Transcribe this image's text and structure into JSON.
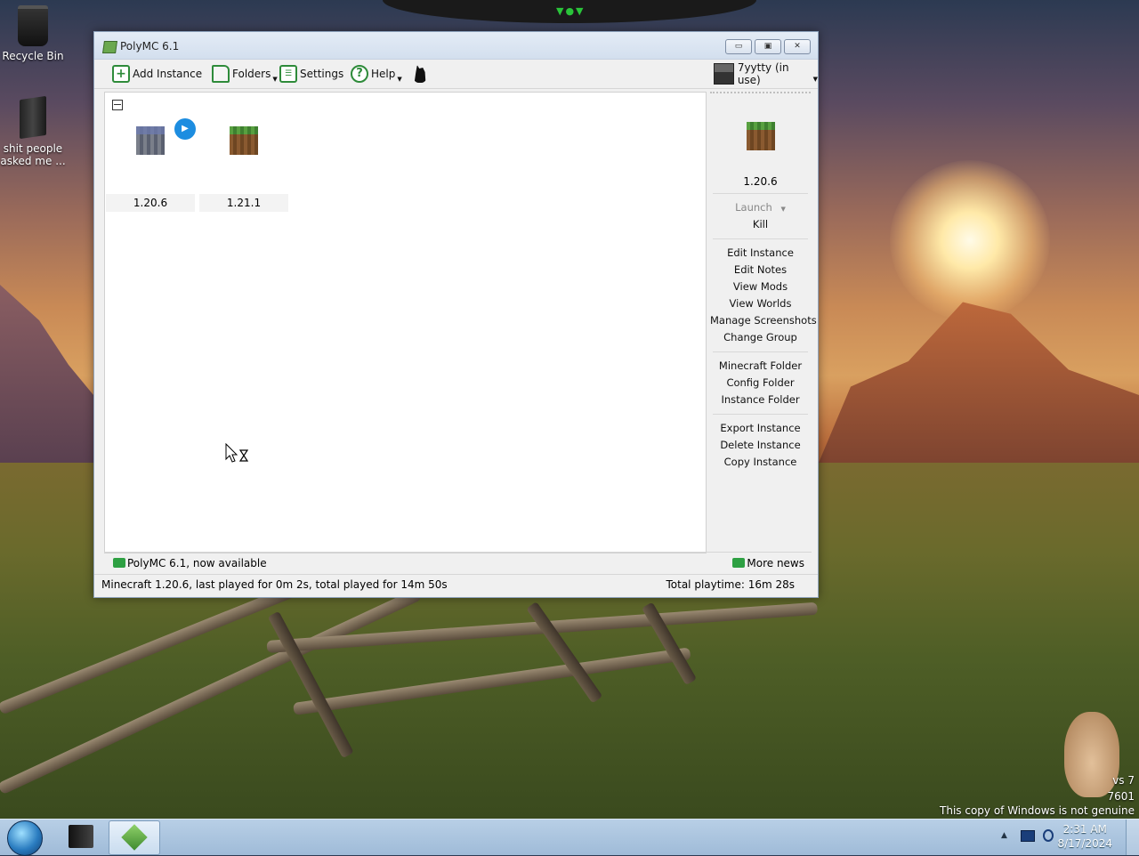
{
  "desktop": {
    "icons": [
      {
        "label": "Recycle Bin"
      },
      {
        "label_line1": "shit people",
        "label_line2": "asked me ..."
      }
    ],
    "watermark": {
      "line1": "vs 7",
      "line2": "7601",
      "line3": "This copy of Windows is not genuine"
    }
  },
  "window": {
    "title": "PolyMC 6.1",
    "controls": {
      "minimize": "▭",
      "maximize": "▣",
      "close": "✕"
    }
  },
  "toolbar": {
    "add_instance": "Add Instance",
    "folders": "Folders",
    "settings": "Settings",
    "help": "Help",
    "account": "7yytty (in use)"
  },
  "instances": [
    {
      "name": "1.20.6",
      "icon": "stone-block-icon"
    },
    {
      "name": "1.21.1",
      "icon": "grass-block-icon"
    }
  ],
  "side_panel": {
    "selected_instance": "1.20.6",
    "launch": "Launch",
    "kill": "Kill",
    "group1": [
      "Edit Instance",
      "Edit Notes",
      "View Mods",
      "View Worlds",
      "Manage Screenshots",
      "Change Group"
    ],
    "group2": [
      "Minecraft Folder",
      "Config Folder",
      "Instance Folder"
    ],
    "group3": [
      "Export Instance",
      "Delete Instance",
      "Copy Instance"
    ]
  },
  "news": {
    "headline": "PolyMC 6.1, now available",
    "more": "More news"
  },
  "status": {
    "left": "Minecraft 1.20.6, last played for 0m 2s, total played for 14m 50s",
    "right": "Total playtime: 16m 28s"
  },
  "taskbar": {
    "time": "2:31 AM",
    "date": "8/17/2024",
    "tray_arrow": "▲"
  }
}
